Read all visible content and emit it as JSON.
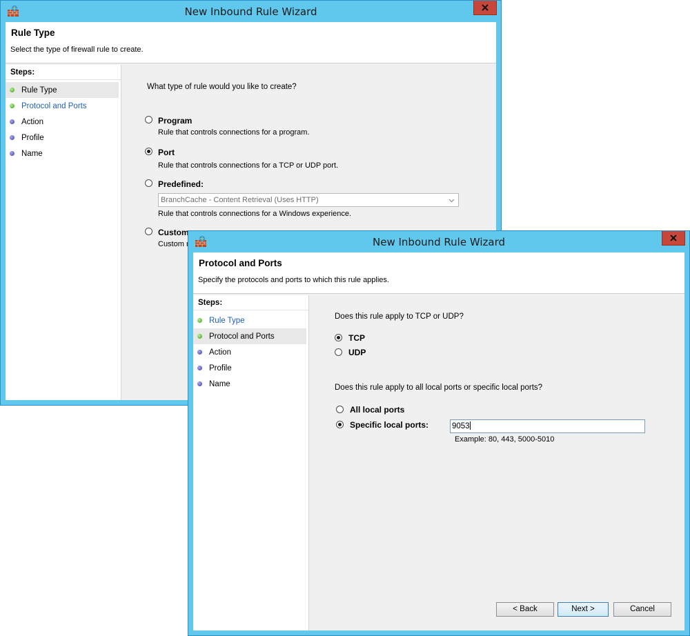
{
  "window1": {
    "title": "New Inbound Rule Wizard",
    "header_title": "Rule Type",
    "header_desc": "Select the type of firewall rule to create.",
    "steps_label": "Steps:",
    "steps": [
      "Rule Type",
      "Protocol and Ports",
      "Action",
      "Profile",
      "Name"
    ],
    "question": "What type of rule would you like to create?",
    "options": {
      "program": {
        "label": "Program",
        "desc": "Rule that controls connections for a program."
      },
      "port": {
        "label": "Port",
        "desc": "Rule that controls connections for a TCP or UDP port."
      },
      "predefined": {
        "label": "Predefined:",
        "select_value": "BranchCache - Content Retrieval (Uses HTTP)",
        "desc": "Rule that controls connections for a Windows experience."
      },
      "custom": {
        "label": "Custom",
        "desc": "Custom ru"
      }
    },
    "selected_option": "Port"
  },
  "window2": {
    "title": "New Inbound Rule Wizard",
    "header_title": "Protocol and Ports",
    "header_desc": "Specify the protocols and ports to which this rule applies.",
    "steps_label": "Steps:",
    "steps": [
      "Rule Type",
      "Protocol and Ports",
      "Action",
      "Profile",
      "Name"
    ],
    "protocol_question": "Does this rule apply to TCP or UDP?",
    "tcp_label": "TCP",
    "udp_label": "UDP",
    "selected_protocol": "TCP",
    "ports_question": "Does this rule apply to all local ports or specific local ports?",
    "all_ports_label": "All local ports",
    "specific_ports_label": "Specific local ports:",
    "selected_ports_option": "Specific local ports",
    "ports_value": "9053",
    "ports_example": "Example: 80, 443, 5000-5010",
    "buttons": {
      "back": "< Back",
      "next": "Next >",
      "cancel": "Cancel"
    }
  },
  "colors": {
    "frame": "#5fc8ec",
    "close": "#c7483a",
    "step_done": "#3f9b1e",
    "step_pending": "#3f3fa9",
    "link": "#1e5fb8"
  },
  "icons": [
    "firewall-icon",
    "close-icon",
    "chevron-down-icon",
    "step-complete-icon",
    "step-pending-icon"
  ]
}
